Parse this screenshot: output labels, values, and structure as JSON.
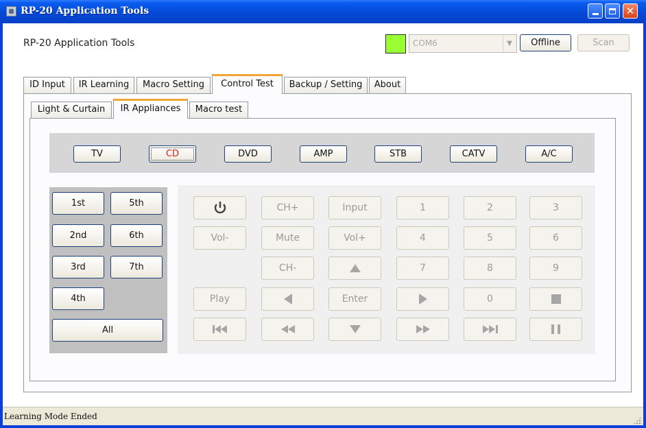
{
  "window": {
    "title": "RP-20 Application Tools"
  },
  "header": {
    "app_label": "RP-20 Application Tools",
    "status_color": "#99ff33",
    "port": {
      "value": "COM6"
    },
    "offline_label": "Offline",
    "scan_label": "Scan"
  },
  "main_tabs": [
    {
      "label": "ID Input"
    },
    {
      "label": "IR Learning"
    },
    {
      "label": "Macro Setting"
    },
    {
      "label": "Control Test",
      "active": true
    },
    {
      "label": "Backup / Setting"
    },
    {
      "label": "About"
    }
  ],
  "sub_tabs": [
    {
      "label": "Light & Curtain"
    },
    {
      "label": "IR Appliances",
      "active": true
    },
    {
      "label": "Macro test"
    }
  ],
  "devices": [
    {
      "label": "TV"
    },
    {
      "label": "CD",
      "selected": true
    },
    {
      "label": "DVD"
    },
    {
      "label": "AMP"
    },
    {
      "label": "STB"
    },
    {
      "label": "CATV"
    },
    {
      "label": "A/C"
    }
  ],
  "macros": [
    {
      "label": "1st"
    },
    {
      "label": "5th"
    },
    {
      "label": "2nd"
    },
    {
      "label": "6th"
    },
    {
      "label": "3rd"
    },
    {
      "label": "7th"
    },
    {
      "label": "4th"
    },
    {
      "label": "All"
    }
  ],
  "remote": {
    "power_icon": "power-icon",
    "ch_up": "CH+",
    "input": "Input",
    "vol_down": "Vol-",
    "mute": "Mute",
    "vol_up": "Vol+",
    "ch_down": "CH-",
    "play": "Play",
    "enter": "Enter",
    "digits": [
      "1",
      "2",
      "3",
      "4",
      "5",
      "6",
      "7",
      "8",
      "9",
      "0"
    ]
  },
  "status_bar": {
    "text": "Learning Mode Ended"
  }
}
